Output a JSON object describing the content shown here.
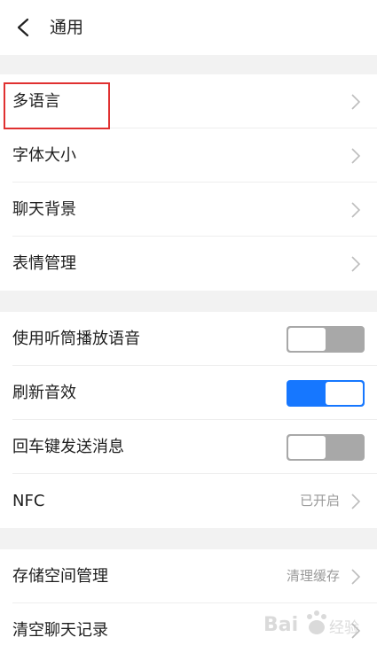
{
  "header": {
    "title": "通用"
  },
  "groups": [
    {
      "items": [
        {
          "label": "多语言"
        },
        {
          "label": "字体大小"
        },
        {
          "label": "聊天背景"
        },
        {
          "label": "表情管理"
        }
      ]
    },
    {
      "items": [
        {
          "label": "使用听筒播放语音",
          "toggle": "off"
        },
        {
          "label": "刷新音效",
          "toggle": "on"
        },
        {
          "label": "回车键发送消息",
          "toggle": "off"
        },
        {
          "label": "NFC",
          "value": "已开启"
        }
      ]
    },
    {
      "items": [
        {
          "label": "存储空间管理",
          "value": "清理缓存"
        },
        {
          "label": "清空聊天记录"
        }
      ]
    }
  ],
  "colors": {
    "accent": "#1677ff",
    "highlight": "#e03030",
    "toggle_off": "#a8a8a8"
  },
  "watermark": {
    "text": "Bai 经验"
  }
}
